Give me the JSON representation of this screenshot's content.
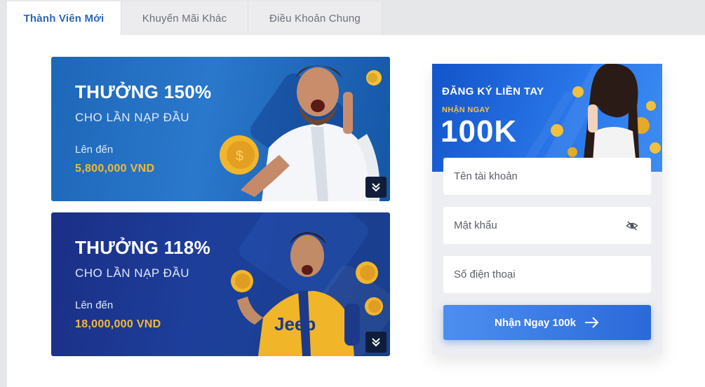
{
  "tabs": [
    {
      "label": "Thành Viên Mới",
      "active": true
    },
    {
      "label": "Khuyến Mãi Khác",
      "active": false
    },
    {
      "label": "Điều Khoản Chung",
      "active": false
    }
  ],
  "banners": [
    {
      "title": "THƯỞNG 150%",
      "subtitle": "CHO LẦN NẠP ĐẦU",
      "upto_label": "Lên đến",
      "amount": "5,800,000 VND"
    },
    {
      "title": "THƯỞNG 118%",
      "subtitle": "CHO LẦN NẠP ĐẦU",
      "upto_label": "Lên đến",
      "amount": "18,000,000 VND"
    }
  ],
  "register": {
    "hero": {
      "line1": "ĐĂNG KÝ LIỀN TAY",
      "line2": "NHẬN NGAY",
      "line3": "100K"
    },
    "username_placeholder": "Tên tài khoản",
    "password_placeholder": "Mật khẩu",
    "phone_placeholder": "Số điện thoại",
    "submit_label": "Nhận Ngay 100k"
  },
  "colors": {
    "accent": "#2c64b8",
    "gold": "#f4b93a",
    "button": "#2a69d8"
  },
  "icons": {
    "expand": "double-chevron-down-icon",
    "password_toggle": "eye-off-icon",
    "submit": "arrow-right-icon"
  }
}
